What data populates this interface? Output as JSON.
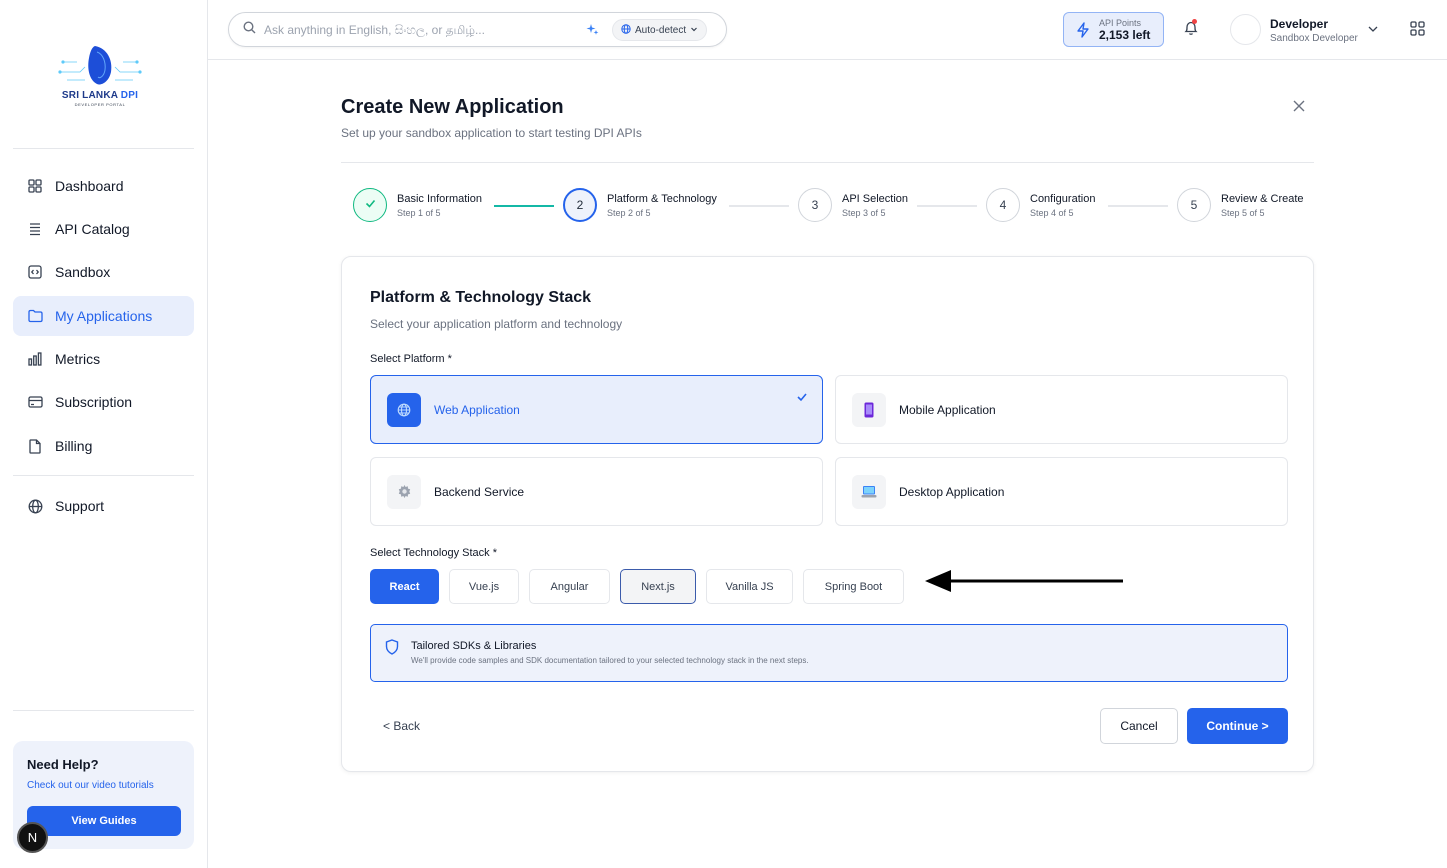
{
  "logo": {
    "text_main": "SRI LANKA ",
    "text_accent": "DPI",
    "subtitle": "DEVELOPER PORTAL"
  },
  "sidebar": {
    "items": [
      {
        "label": "Dashboard",
        "icon": "dashboard-grid-icon"
      },
      {
        "label": "API Catalog",
        "icon": "list-icon"
      },
      {
        "label": "Sandbox",
        "icon": "code-box-icon"
      },
      {
        "label": "My Applications",
        "icon": "folder-icon",
        "active": true
      },
      {
        "label": "Metrics",
        "icon": "bar-chart-icon"
      },
      {
        "label": "Subscription",
        "icon": "credit-card-icon"
      },
      {
        "label": "Billing",
        "icon": "file-icon"
      },
      {
        "label": "Support",
        "icon": "globe-icon"
      }
    ],
    "help": {
      "title": "Need Help?",
      "subtitle": "Check out our video tutorials",
      "button": "View Guides"
    },
    "badge": "N"
  },
  "header": {
    "search_placeholder": "Ask anything in English, සිංහල, or தமிழ்...",
    "language": "Auto-detect",
    "api_points_label": "API Points",
    "api_points_value": "2,153 left",
    "user_name": "Developer",
    "user_role": "Sandbox Developer"
  },
  "page": {
    "title": "Create New Application",
    "subtitle": "Set up your sandbox application to start testing DPI APIs"
  },
  "steps": [
    {
      "name": "Basic Information",
      "sub": "Step 1 of 5",
      "number": "1",
      "state": "done"
    },
    {
      "name": "Platform & Technology",
      "sub": "Step 2 of 5",
      "number": "2",
      "state": "current"
    },
    {
      "name": "API Selection",
      "sub": "Step 3 of 5",
      "number": "3",
      "state": "pending"
    },
    {
      "name": "Configuration",
      "sub": "Step 4 of 5",
      "number": "4",
      "state": "pending"
    },
    {
      "name": "Review & Create",
      "sub": "Step 5 of 5",
      "number": "5",
      "state": "pending"
    }
  ],
  "card": {
    "title": "Platform & Technology Stack",
    "subtitle": "Select your application platform and technology",
    "platform_label": "Select Platform *",
    "platforms": [
      {
        "label": "Web Application",
        "selected": true
      },
      {
        "label": "Mobile Application",
        "selected": false
      },
      {
        "label": "Backend Service",
        "selected": false
      },
      {
        "label": "Desktop Application",
        "selected": false
      }
    ],
    "tech_label": "Select Technology Stack *",
    "tech": [
      "React",
      "Vue.js",
      "Angular",
      "Next.js",
      "Vanilla JS",
      "Spring Boot"
    ],
    "tech_selected": "React",
    "info_title": "Tailored SDKs & Libraries",
    "info_text": "We'll provide code samples and SDK documentation tailored to your selected technology stack in the next steps.",
    "back": "< Back",
    "cancel": "Cancel",
    "continue": "Continue >"
  },
  "colors": {
    "accent": "#2563eb",
    "success": "#10b981",
    "progress": "#14b8a6"
  }
}
